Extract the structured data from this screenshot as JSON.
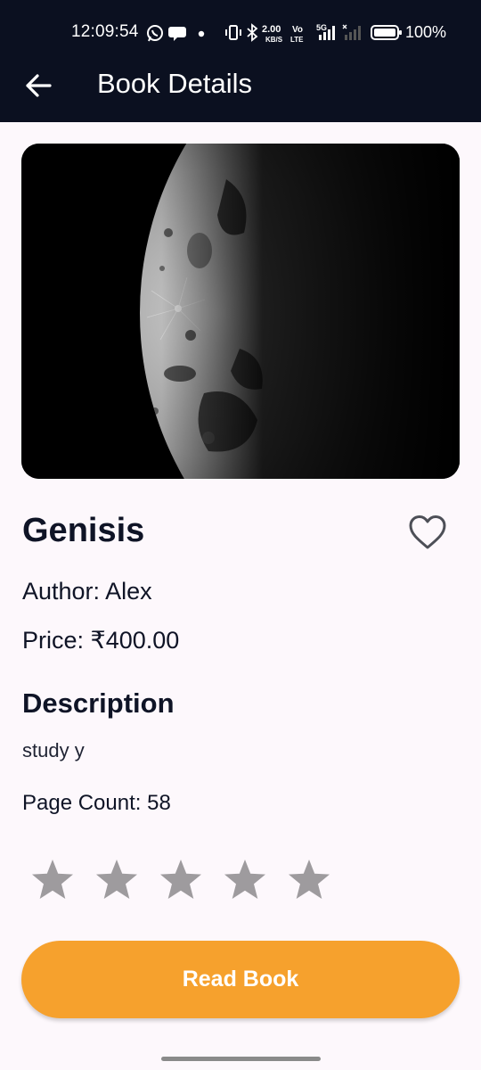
{
  "status_bar": {
    "time": "12:09:54",
    "net_speed_top": "2.00",
    "net_speed_bottom": "KB/S",
    "volte_top": "Vo",
    "volte_bottom": "LTE",
    "network": "5G",
    "battery": "100%",
    "icons": [
      "whatsapp-icon",
      "chat-bubble-icon",
      "dot-icon",
      "vibrate-icon",
      "bluetooth-icon",
      "signal-icon",
      "battery-icon"
    ]
  },
  "app_bar": {
    "title": "Book Details",
    "back_icon": "arrow-left-icon",
    "color": "#0b1020"
  },
  "book": {
    "cover_image": "moon-cover-image",
    "title": "Genisis",
    "favorite_icon": "heart-outline-icon",
    "author": "Author: Alex",
    "price": "Price: ₹400.00",
    "description_heading": "Description",
    "description": "study y",
    "page_count": "Page Count: 58"
  },
  "rating": {
    "max": 5,
    "value": 0,
    "star_color": "#9e9b9e"
  },
  "actions": {
    "read_label": "Read Book",
    "read_color": "#f6a12d"
  }
}
